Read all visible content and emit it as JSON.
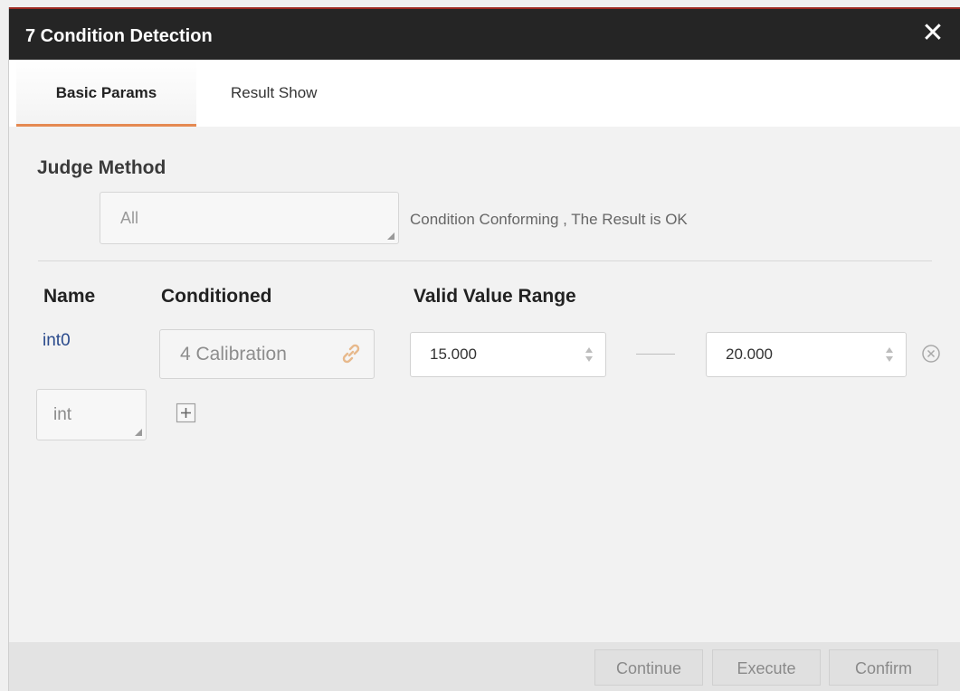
{
  "dialog": {
    "title": "7 Condition Detection",
    "close_symbol": "✕"
  },
  "tabs": [
    {
      "label": "Basic Params",
      "active": true
    },
    {
      "label": "Result Show",
      "active": false
    }
  ],
  "judge": {
    "section_label": "Judge Method",
    "selected_value": "All",
    "hint": "Condition Conforming , The Result is OK"
  },
  "conditions": {
    "headers": {
      "name": "Name",
      "conditioned": "Conditioned",
      "range": "Valid Value Range"
    },
    "rows": [
      {
        "name": "int0",
        "conditioned": "4 Calibration",
        "min": "15.000",
        "max": "20.000"
      }
    ],
    "type_selected": "int"
  },
  "footer": {
    "continue_label": "Continue",
    "execute_label": "Execute",
    "confirm_label": "Confirm"
  },
  "colors": {
    "titlebar": "#252525",
    "accent_tab": "#e58a52",
    "title_top_border": "#9e2a22",
    "name_text": "#2a4a8c"
  },
  "icons": [
    "close-icon",
    "link-icon",
    "spin-arrows-icon",
    "remove-circle-icon",
    "add-square-icon",
    "dropdown-corner-icon"
  ]
}
